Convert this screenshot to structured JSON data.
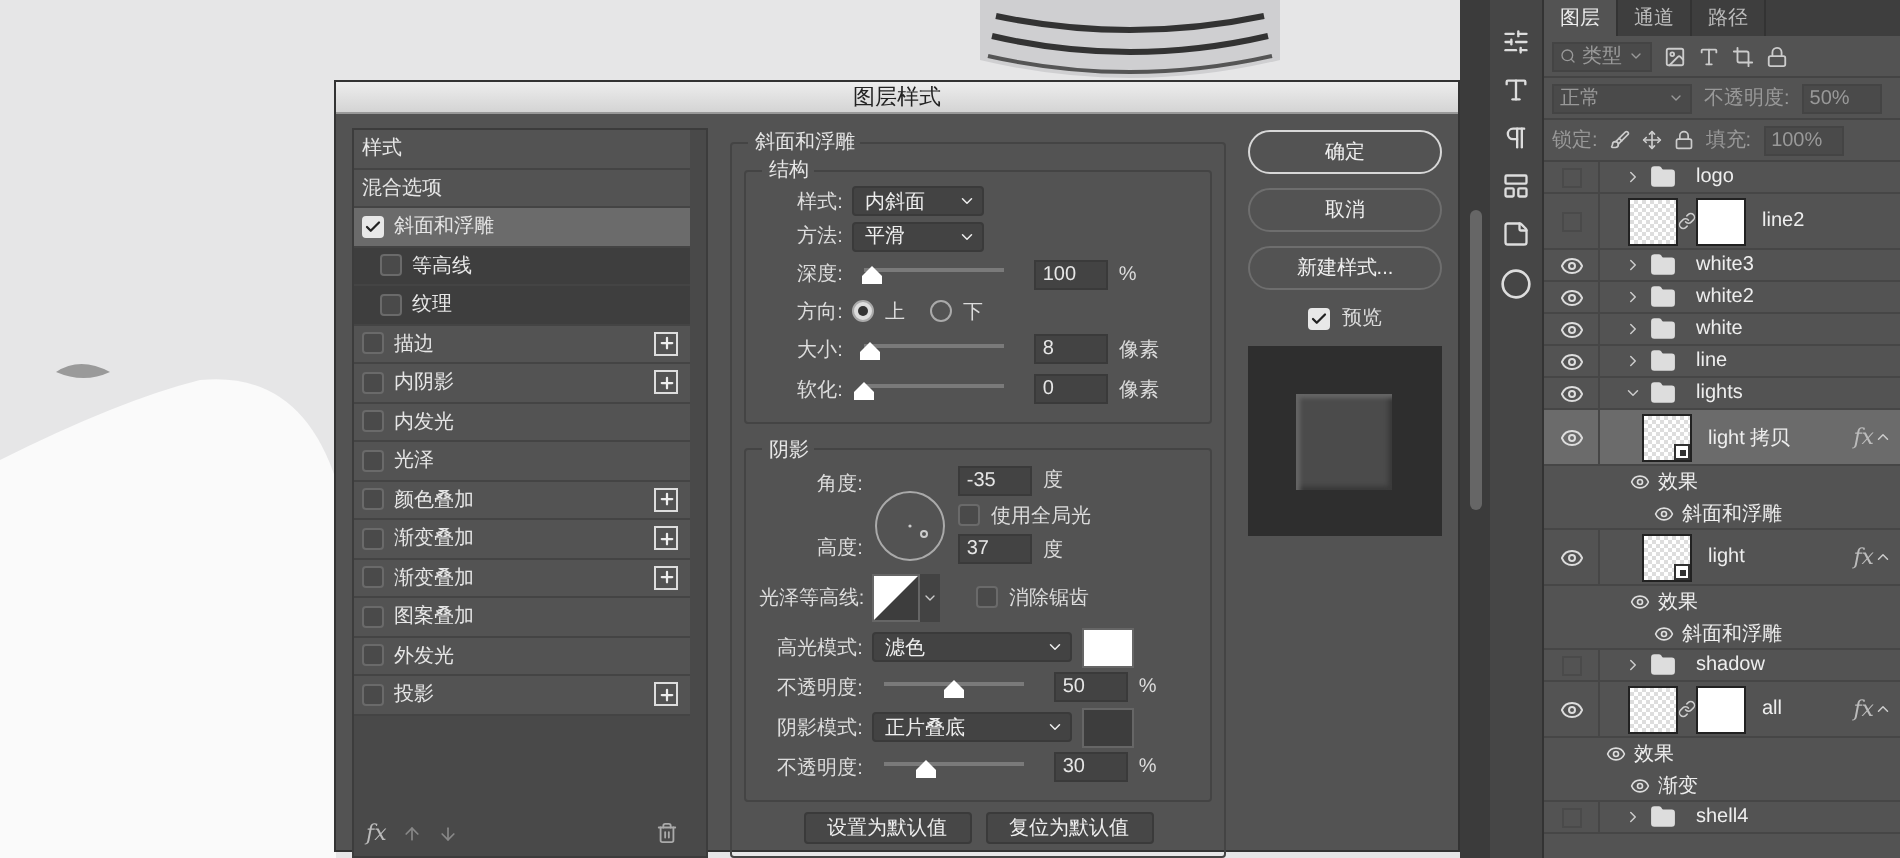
{
  "dialog": {
    "title": "图层样式",
    "styles": [
      {
        "kind": "header",
        "label": "样式",
        "selected": false
      },
      {
        "kind": "header",
        "label": "混合选项",
        "selected": false
      },
      {
        "kind": "item",
        "label": "斜面和浮雕",
        "checked": true,
        "selected": true,
        "plus": false
      },
      {
        "kind": "sub",
        "label": "等高线",
        "checked": false,
        "selected": false
      },
      {
        "kind": "sub",
        "label": "纹理",
        "checked": false,
        "selected": false
      },
      {
        "kind": "item",
        "label": "描边",
        "checked": false,
        "selected": false,
        "plus": true
      },
      {
        "kind": "item",
        "label": "内阴影",
        "checked": false,
        "selected": false,
        "plus": true
      },
      {
        "kind": "item",
        "label": "内发光",
        "checked": false,
        "selected": false,
        "plus": false
      },
      {
        "kind": "item",
        "label": "光泽",
        "checked": false,
        "selected": false,
        "plus": false
      },
      {
        "kind": "item",
        "label": "颜色叠加",
        "checked": false,
        "selected": false,
        "plus": true
      },
      {
        "kind": "item",
        "label": "渐变叠加",
        "checked": false,
        "selected": false,
        "plus": true
      },
      {
        "kind": "item",
        "label": "渐变叠加",
        "checked": false,
        "selected": false,
        "plus": true
      },
      {
        "kind": "item",
        "label": "图案叠加",
        "checked": false,
        "selected": false,
        "plus": false
      },
      {
        "kind": "item",
        "label": "外发光",
        "checked": false,
        "selected": false,
        "plus": false
      },
      {
        "kind": "item",
        "label": "投影",
        "checked": false,
        "selected": false,
        "plus": true
      }
    ],
    "footer_fx": "fx",
    "bevel": {
      "title": "斜面和浮雕",
      "structure": {
        "title": "结构",
        "rows": [
          {
            "kind": "select",
            "label": "样式:",
            "value": "内斜面"
          },
          {
            "kind": "select",
            "label": "方法:",
            "value": "平滑"
          },
          {
            "kind": "slider",
            "label": "深度:",
            "level": 0.05,
            "value": "100",
            "unit": "%"
          },
          {
            "kind": "radio",
            "label": "方向:",
            "options": [
              {
                "label": "上",
                "selected": true
              },
              {
                "label": "下",
                "selected": false
              }
            ]
          },
          {
            "kind": "slider",
            "label": "大小:",
            "level": 0.04,
            "value": "8",
            "unit": "像素"
          },
          {
            "kind": "slider",
            "label": "软化:",
            "level": 0,
            "value": "0",
            "unit": "像素"
          }
        ]
      },
      "shadow": {
        "title": "阴影",
        "angle": {
          "label": "角度:",
          "value": "-35",
          "unit": "度"
        },
        "global_light": {
          "label": "使用全局光",
          "checked": false
        },
        "altitude": {
          "label": "高度:",
          "value": "37",
          "unit": "度"
        },
        "gloss_contour": {
          "label": "光泽等高线:"
        },
        "anti_alias": {
          "label": "消除锯齿",
          "checked": false
        },
        "rows": [
          {
            "kind": "mode",
            "label": "高光模式:",
            "value": "滤色",
            "color": "#ffffff"
          },
          {
            "kind": "slider",
            "label": "不透明度:",
            "level": 0.5,
            "value": "50",
            "unit": "%"
          },
          {
            "kind": "mode",
            "label": "阴影模式:",
            "value": "正片叠底",
            "color": "#3d3d3d"
          },
          {
            "kind": "slider",
            "label": "不透明度:",
            "level": 0.3,
            "value": "30",
            "unit": "%"
          }
        ]
      },
      "buttons": [
        "设置为默认值",
        "复位为默认值"
      ]
    },
    "actions": [
      {
        "label": "确定",
        "default": true
      },
      {
        "label": "取消",
        "default": false
      },
      {
        "label": "新建样式...",
        "default": false
      }
    ],
    "preview": {
      "label": "预览",
      "checked": true
    }
  },
  "layers_panel": {
    "tabs": [
      {
        "label": "图层",
        "selected": true
      },
      {
        "label": "通道",
        "selected": false
      },
      {
        "label": "路径",
        "selected": false
      }
    ],
    "filter": "类型",
    "blend_mode": "正常",
    "opacity_label": "不透明度:",
    "opacity": "50%",
    "lock_label": "锁定:",
    "fill_label": "填充:",
    "fill": "100%",
    "layers": [
      {
        "kind": "group",
        "name": "logo",
        "visible": false,
        "expanded": false,
        "selected": false
      },
      {
        "kind": "masked",
        "name": "line2",
        "visible": false,
        "selected": false
      },
      {
        "kind": "group",
        "name": "white3",
        "visible": true,
        "expanded": false,
        "selected": false
      },
      {
        "kind": "group",
        "name": "white2",
        "visible": true,
        "expanded": false,
        "selected": false
      },
      {
        "kind": "group",
        "name": "white",
        "visible": true,
        "expanded": false,
        "selected": false
      },
      {
        "kind": "group",
        "name": "line",
        "visible": true,
        "expanded": false,
        "selected": false
      },
      {
        "kind": "group",
        "name": "lights",
        "visible": true,
        "expanded": true,
        "selected": false,
        "children": [
          {
            "kind": "smart",
            "name": "light 拷贝",
            "visible": true,
            "selected": true,
            "fx": "fx",
            "effects": {
              "label": "效果",
              "items": [
                "斜面和浮雕"
              ]
            }
          },
          {
            "kind": "smart",
            "name": "light",
            "visible": true,
            "selected": false,
            "fx": "fx",
            "effects": {
              "label": "效果",
              "items": [
                "斜面和浮雕"
              ]
            }
          }
        ]
      },
      {
        "kind": "group",
        "name": "shadow",
        "visible": false,
        "expanded": false,
        "selected": false
      },
      {
        "kind": "masked",
        "name": "all",
        "visible": true,
        "selected": false,
        "fx": "fx",
        "effects": {
          "label": "效果",
          "items": [
            "渐变"
          ]
        }
      },
      {
        "kind": "group",
        "name": "shell4",
        "visible": false,
        "expanded": false,
        "selected": false
      }
    ]
  }
}
